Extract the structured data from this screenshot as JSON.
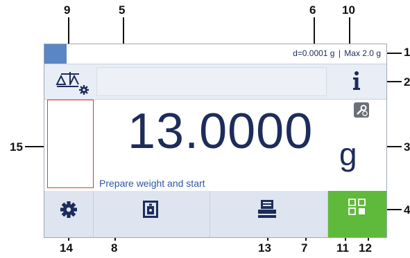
{
  "callouts": {
    "n1": "1",
    "n2": "2",
    "n3": "3",
    "n4": "4",
    "n5": "5",
    "n6": "6",
    "n7": "7",
    "n8": "8",
    "n9": "9",
    "n10": "10",
    "n11": "11",
    "n12": "12",
    "n13": "13",
    "n14": "14",
    "n15": "15"
  },
  "statusbar": {
    "readability": "d=0.0001 g",
    "separator": "|",
    "capacity": "Max 2.0 g"
  },
  "toolbar": {
    "balance_icon": "balance-settings-icon",
    "info_icon": "info-icon"
  },
  "main": {
    "weight_value": "13.0000",
    "unit": "g",
    "message": "Prepare weight and start"
  },
  "bottombar": {
    "settings_icon": "gear-icon",
    "tare_icon": "weight-icon",
    "print_icon": "printer-icon",
    "apps_icon": "apps-icon"
  },
  "colors": {
    "accent_blue": "#1d2c5a",
    "status_square": "#5b86c5",
    "alert_red": "#e0373b",
    "green": "#5fb93a"
  }
}
